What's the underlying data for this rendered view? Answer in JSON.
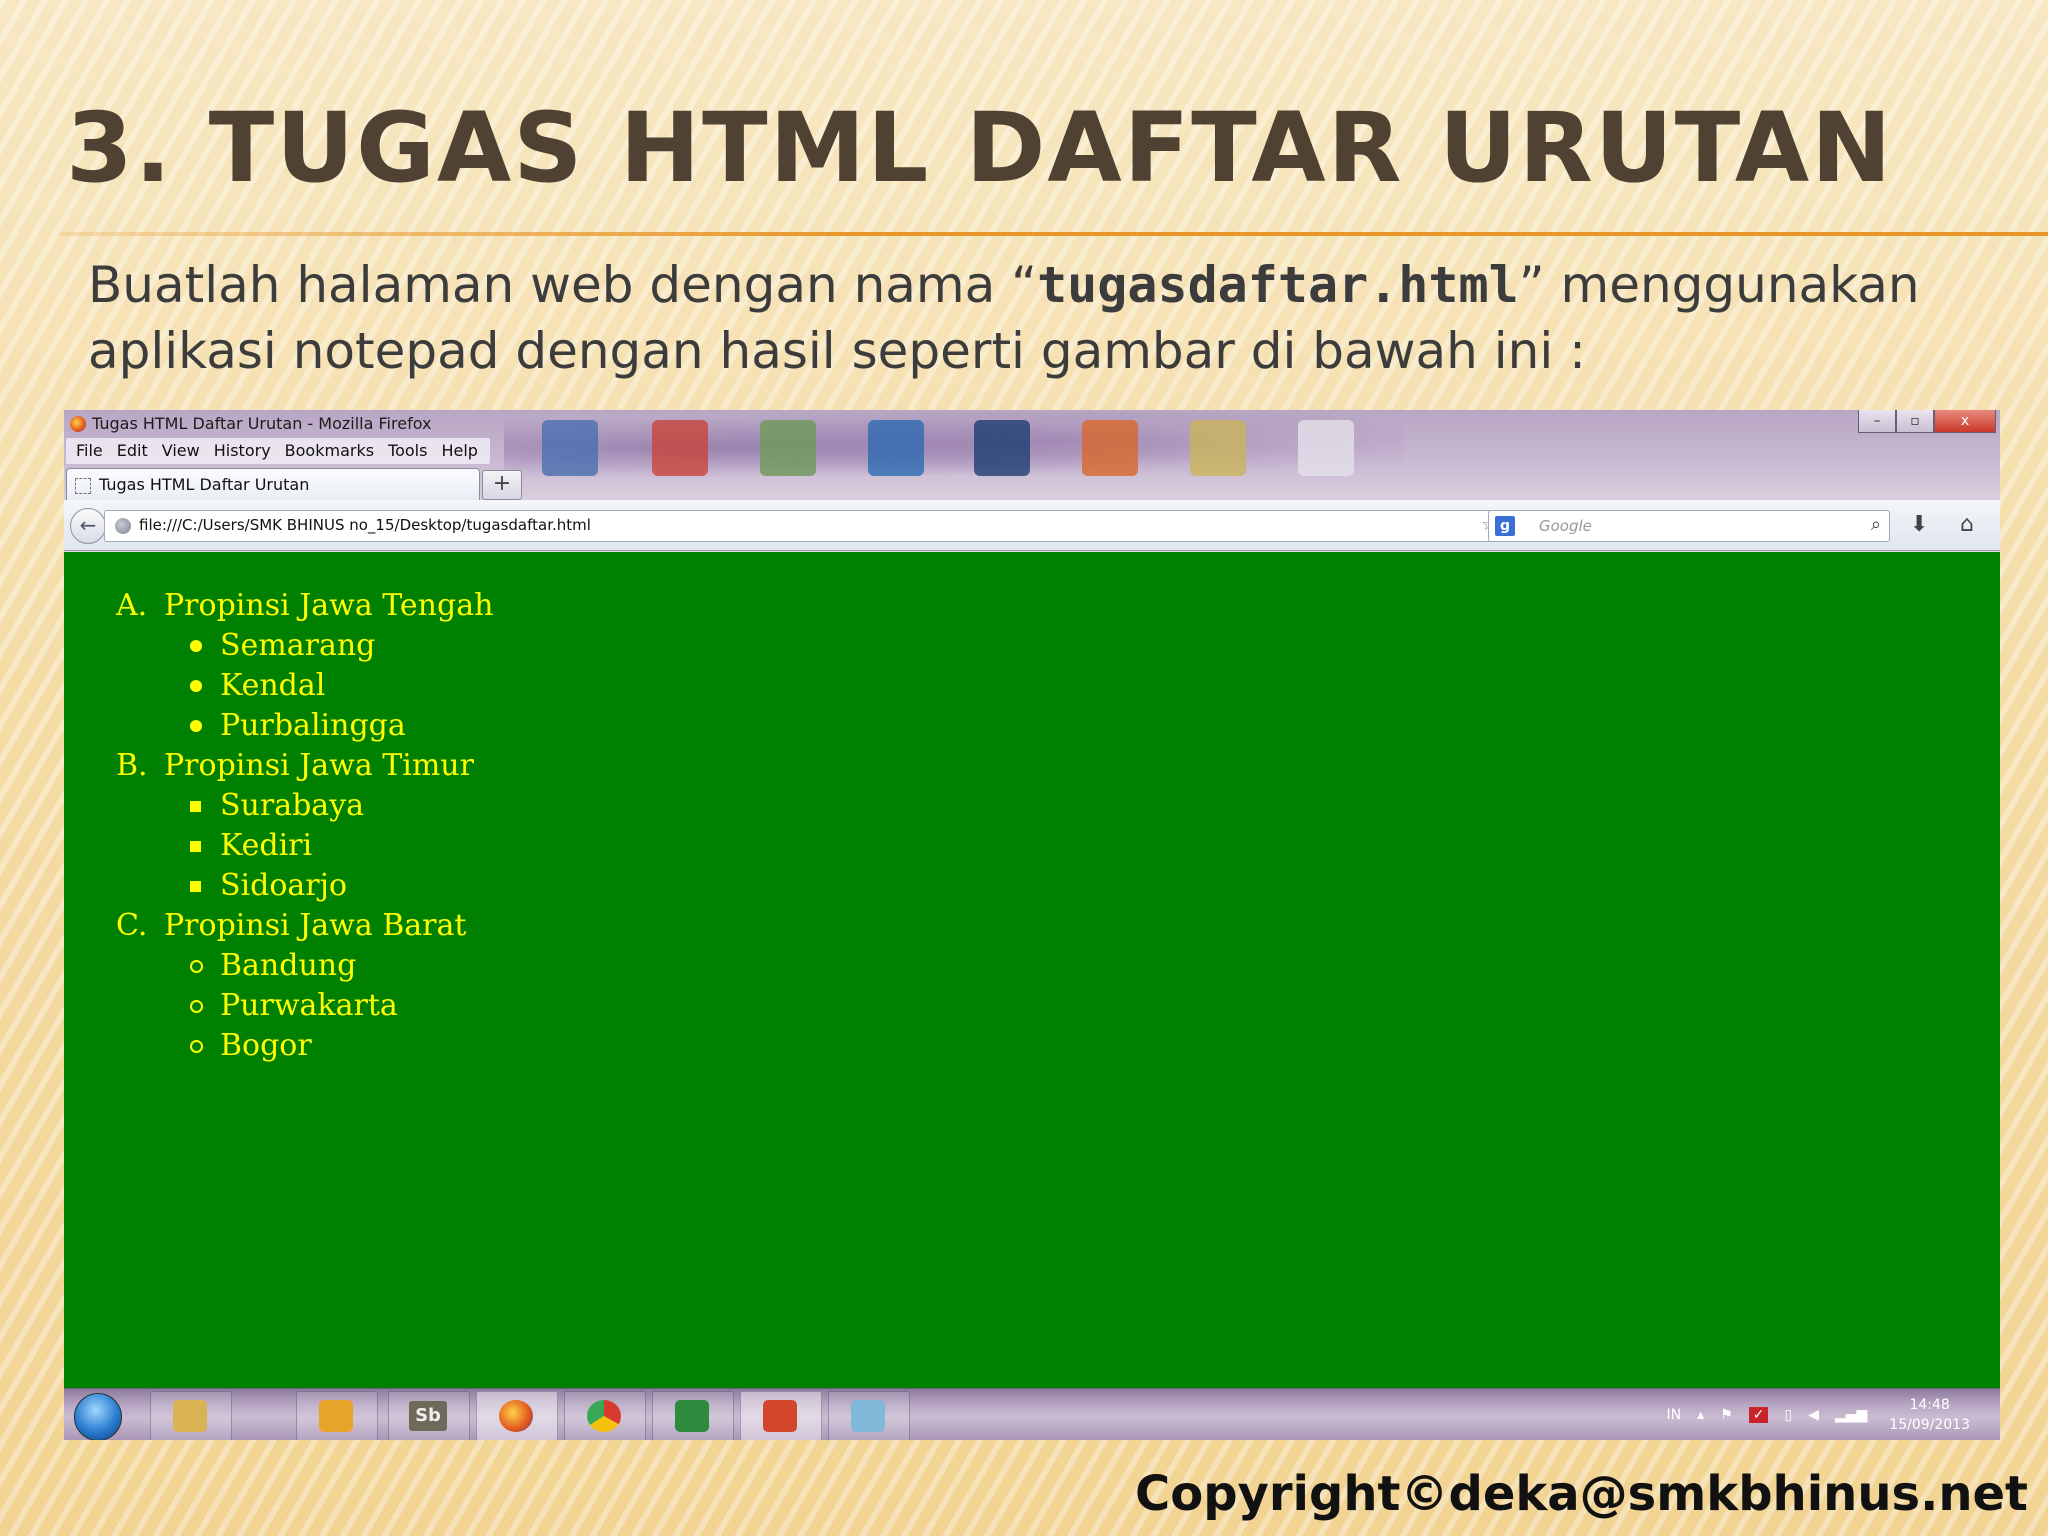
{
  "slide": {
    "title": "3. TUGAS HTML DAFTAR URUTAN",
    "instruction_before": "Buatlah halaman web dengan nama “",
    "instruction_filename": "tugasdaftar.html",
    "instruction_after": "” menggunakan aplikasi notepad dengan hasil seperti gambar di bawah ini :",
    "copyright": "Copyright©deka@smkbhinus.net"
  },
  "browser": {
    "window_title": "Tugas HTML Daftar Urutan - Mozilla Firefox",
    "window_controls": [
      "–",
      "▫",
      "x"
    ],
    "menu": [
      "File",
      "Edit",
      "View",
      "History",
      "Bookmarks",
      "Tools",
      "Help"
    ],
    "tab_label": "Tugas HTML Daftar Urutan",
    "new_tab": "+",
    "url": "file:///C:/Users/SMK BHINUS no_15/Desktop/tugasdaftar.html",
    "search_placeholder": "Google"
  },
  "page": {
    "background_color": "#008000",
    "text_color": "#ffff00",
    "provinces": [
      {
        "marker": "A.",
        "name": "Propinsi Jawa Tengah",
        "bullet": "disc",
        "cities": [
          "Semarang",
          "Kendal",
          "Purbalingga"
        ]
      },
      {
        "marker": "B.",
        "name": "Propinsi Jawa Timur",
        "bullet": "square",
        "cities": [
          "Surabaya",
          "Kediri",
          "Sidoarjo"
        ]
      },
      {
        "marker": "C.",
        "name": "Propinsi Jawa Barat",
        "bullet": "circle",
        "cities": [
          "Bandung",
          "Purwakarta",
          "Bogor"
        ]
      }
    ]
  },
  "taskbar": {
    "language": "IN",
    "time": "14:48",
    "date": "15/09/2013",
    "sb_label": "Sb"
  }
}
